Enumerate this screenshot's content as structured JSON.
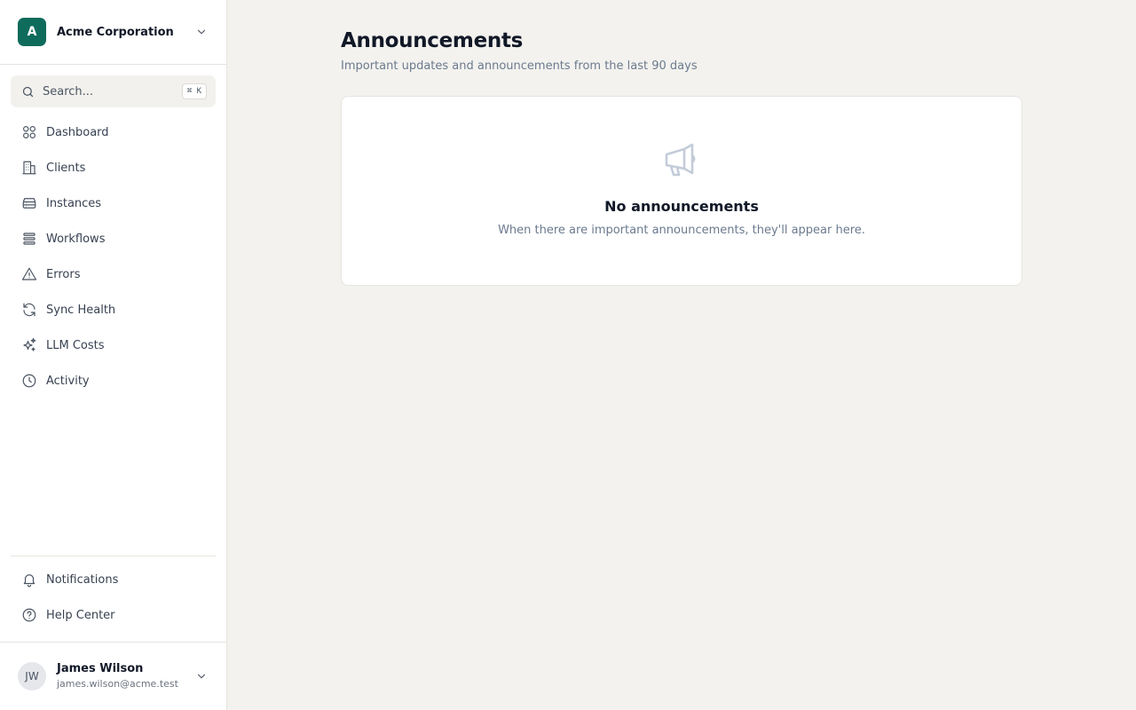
{
  "org": {
    "initial": "A",
    "name": "Acme Corporation",
    "logo_color": "#0f6b5c"
  },
  "search": {
    "placeholder": "Search...",
    "shortcut": "⌘ K"
  },
  "nav": [
    {
      "label": "Dashboard",
      "icon": "grid-icon"
    },
    {
      "label": "Clients",
      "icon": "building-icon"
    },
    {
      "label": "Instances",
      "icon": "server-icon"
    },
    {
      "label": "Workflows",
      "icon": "list-icon"
    },
    {
      "label": "Errors",
      "icon": "alert-triangle-icon"
    },
    {
      "label": "Sync Health",
      "icon": "refresh-icon"
    },
    {
      "label": "LLM Costs",
      "icon": "sparkles-icon"
    },
    {
      "label": "Activity",
      "icon": "clock-icon"
    }
  ],
  "bottom_nav": [
    {
      "label": "Notifications",
      "icon": "bell-icon"
    },
    {
      "label": "Help Center",
      "icon": "help-circle-icon"
    }
  ],
  "user": {
    "initials": "JW",
    "name": "James Wilson",
    "email": "james.wilson@acme.test"
  },
  "page": {
    "title": "Announcements",
    "subtitle": "Important updates and announcements from the last 90 days"
  },
  "empty_state": {
    "icon": "megaphone-icon",
    "title": "No announcements",
    "text": "When there are important announcements, they'll appear here."
  }
}
